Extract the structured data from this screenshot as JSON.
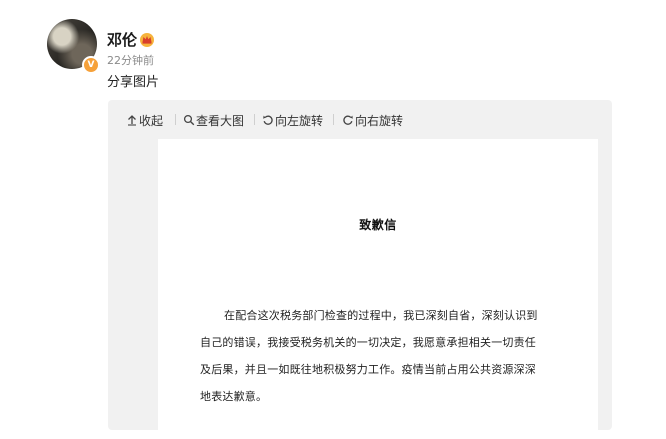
{
  "post": {
    "author": "邓伦",
    "time": "22分钟前",
    "text": "分享图片",
    "verified_icon": "verified-badge-icon",
    "member_icon": "crown-icon"
  },
  "viewer": {
    "toolbar": {
      "collapse": "收起",
      "view_large": "查看大图",
      "rotate_left": "向左旋转",
      "rotate_right": "向右旋转"
    },
    "letter": {
      "title": "致歉信",
      "lines": [
        "在配合这次税务部门检查的过程中，我已深刻自省，深刻认识到",
        "自己的错误，我接受税务机关的一切决定，我愿意承担相关一切责任",
        "及后果，并且一如既往地积极努力工作。疫情当前占用公共资源深深",
        "地表达歉意。"
      ]
    }
  },
  "colors": {
    "badge": "#f6a13a",
    "viewer_bg": "#f1f1f1"
  }
}
